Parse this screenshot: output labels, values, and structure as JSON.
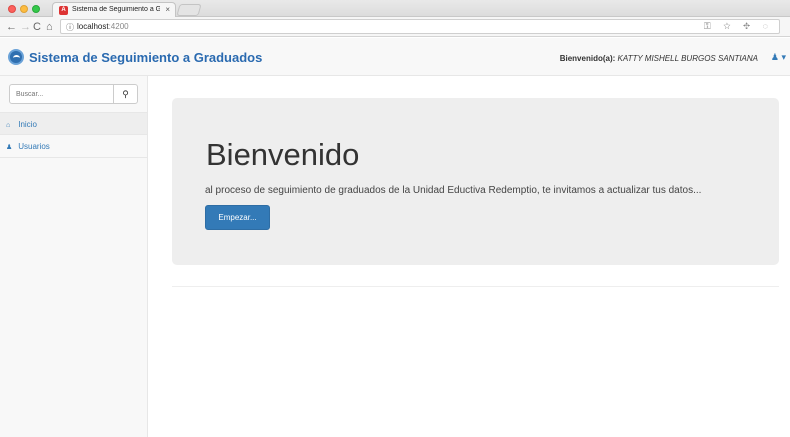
{
  "browser": {
    "tab_title": "Sistema de Seguimiento a Grad",
    "tab_close": "×",
    "url_host": "localhost",
    "url_port": ":4200",
    "omnibox_icons": "⚿ ☆ ✥ ◌"
  },
  "navbar": {
    "brand": "Sistema de Seguimiento a Graduados",
    "welcome_label": "Bienvenido(a):",
    "welcome_user": "KATTY MISHELL BURGOS SANTIANA",
    "user_icon": "user-icon"
  },
  "sidebar": {
    "search_placeholder": "Buscar...",
    "items": [
      {
        "label": "Inicio",
        "icon": "home-icon"
      },
      {
        "label": "Usuarios",
        "icon": "users-icon"
      }
    ]
  },
  "main": {
    "title": "Bienvenido",
    "text": "al proceso de seguimiento de graduados de la Unidad Eductiva Redemptio, te invitamos a actualizar tus datos...",
    "button": "Empezar..."
  },
  "colors": {
    "brand": "#2a6ab0",
    "primary": "#337ab7",
    "jumbotron": "#eeeeee"
  }
}
